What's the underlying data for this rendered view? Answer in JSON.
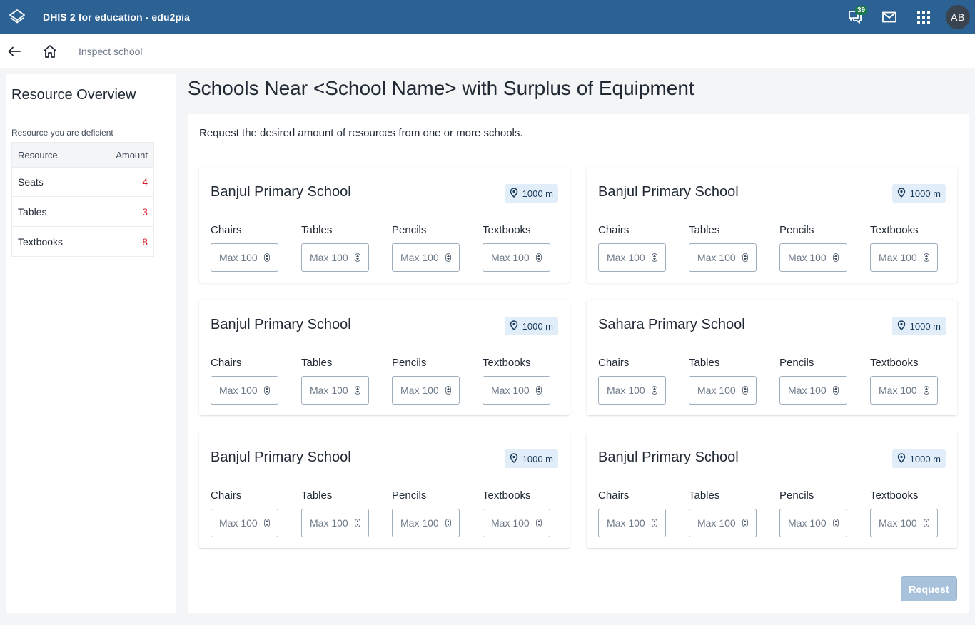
{
  "header": {
    "title": "DHIS 2 for education - edu2pia",
    "message_count": "39",
    "avatar_initials": "AB",
    "icons": [
      "logo-icon",
      "interpretations-icon",
      "mail-icon",
      "apps-grid-icon"
    ]
  },
  "subnav": {
    "breadcrumb": "Inspect school"
  },
  "sidebar": {
    "title": "Resource Overview",
    "deficient_label": "Resource you are deficient",
    "table": {
      "headers": [
        "Resource",
        "Amount"
      ],
      "rows": [
        {
          "resource": "Seats",
          "amount": "-4"
        },
        {
          "resource": "Tables",
          "amount": "-3"
        },
        {
          "resource": "Textbooks",
          "amount": "-8"
        }
      ]
    }
  },
  "main": {
    "title": "Schools Near <School Name> with Surplus of Equipment",
    "intro": "Request the desired amount of resources from one or more schools.",
    "field_labels": [
      "Chairs",
      "Tables",
      "Pencils",
      "Textbooks"
    ],
    "placeholder": "Max 100",
    "cards": [
      {
        "name": "Banjul Primary School",
        "distance": "1000 m"
      },
      {
        "name": "Banjul Primary School",
        "distance": "1000 m"
      },
      {
        "name": "Banjul Primary School",
        "distance": "1000 m"
      },
      {
        "name": "Sahara Primary School",
        "distance": "1000 m"
      },
      {
        "name": "Banjul Primary School",
        "distance": "1000 m"
      },
      {
        "name": "Banjul Primary School",
        "distance": "1000 m"
      }
    ],
    "request_label": "Request"
  },
  "colors": {
    "header_bg": "#2b6193",
    "negative": "#d3202c",
    "badge": "#1b7a4a",
    "distance_tag": "#e1eefa",
    "button_disabled": "#a8c2db"
  }
}
